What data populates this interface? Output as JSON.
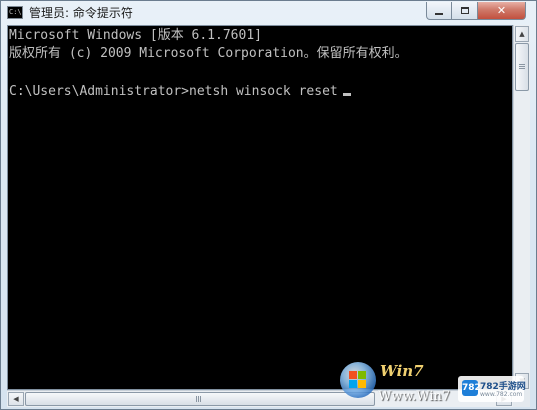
{
  "window": {
    "title": "管理员: 命令提示符",
    "icon": "cmd-icon",
    "icon_text": "C:\\",
    "controls": {
      "minimize": "minimize-icon",
      "maximize": "maximize-icon",
      "close": "close-icon",
      "close_glyph": "✕"
    }
  },
  "console": {
    "lines": [
      "Microsoft Windows [版本 6.1.7601]",
      "版权所有 (c) 2009 Microsoft Corporation。保留所有权利。",
      "C:\\Users\\Administrator>netsh winsock reset"
    ],
    "background": "#000000",
    "foreground": "#c0c0c0"
  },
  "scrollbars": {
    "up_arrow": "▲",
    "down_arrow": "▼",
    "left_arrow": "◀",
    "right_arrow": "▶"
  },
  "watermark": {
    "brand": "Win7",
    "url": "Www.Win7",
    "site_logo": "782",
    "site_name": "782手游网",
    "site_sub": "www.782.com"
  }
}
